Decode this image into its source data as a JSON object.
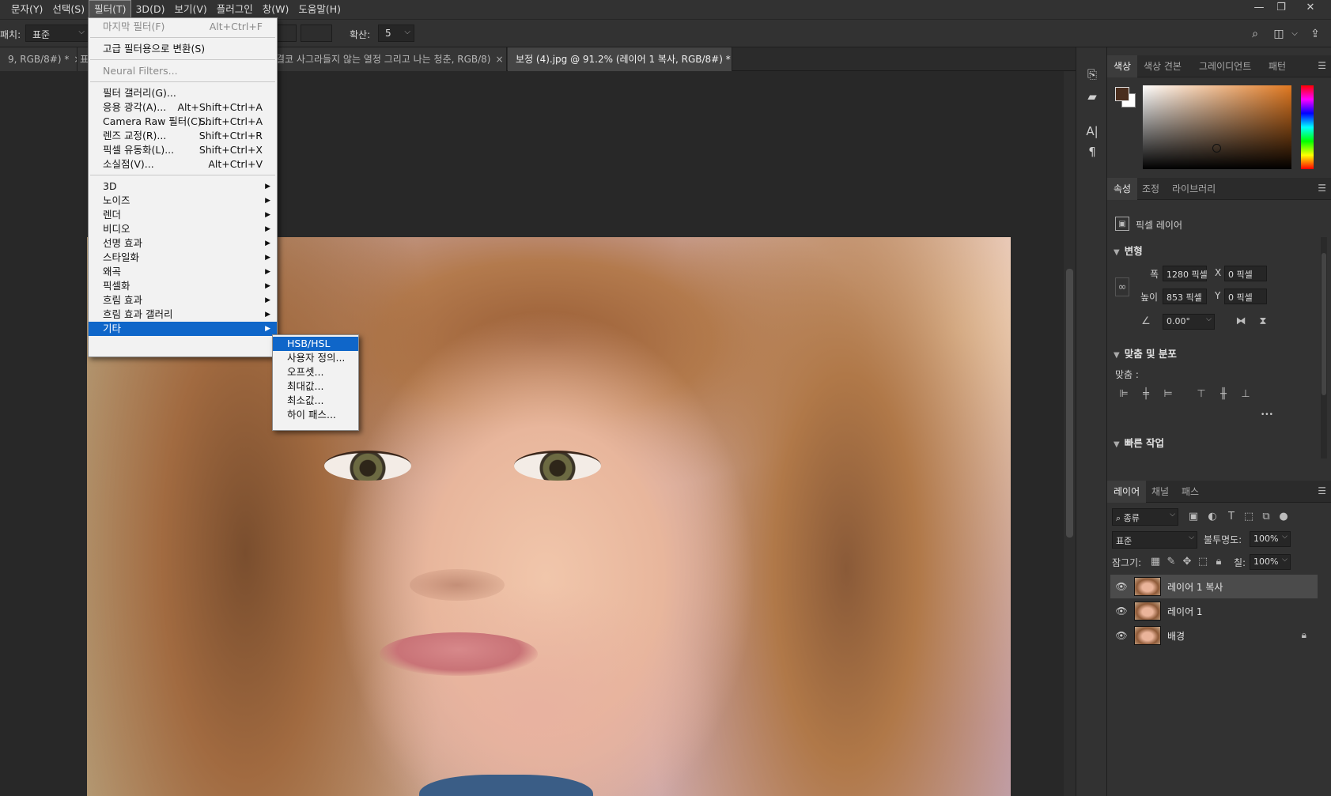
{
  "menubar": {
    "items": [
      "문자(Y)",
      "선택(S)",
      "필터(T)",
      "3D(D)",
      "보기(V)",
      "플러그인",
      "창(W)",
      "도움말(H)"
    ],
    "active_index": 2,
    "window_controls": [
      "—",
      "❐",
      "✕"
    ]
  },
  "options": {
    "patch_label": "패치:",
    "patch_value": "표준",
    "spread_label": "확산:",
    "spread_value": "5"
  },
  "tabs": [
    {
      "label": "9, RGB/8#) *",
      "active": false
    },
    {
      "label": "표",
      "active": false
    },
    {
      "label": "결코 사그라들지 않는 열정 그리고 나는 청춘, RGB/8)",
      "active": false
    },
    {
      "label": "보정 (4).jpg @ 91.2% (레이어 1 복사, RGB/8#) *",
      "active": true
    }
  ],
  "filter_menu": {
    "items": [
      {
        "label": "마지막 필터(F)",
        "shortcut": "Alt+Ctrl+F",
        "disabled": true
      },
      {
        "label": "고급 필터용으로 변환(S)"
      },
      {
        "label": "Neural Filters...",
        "disabled": true
      },
      {
        "label": "필터 갤러리(G)..."
      },
      {
        "label": "응용 광각(A)...",
        "shortcut": "Alt+Shift+Ctrl+A"
      },
      {
        "label": "Camera Raw 필터(C)...",
        "shortcut": "Shift+Ctrl+A"
      },
      {
        "label": "렌즈 교정(R)...",
        "shortcut": "Shift+Ctrl+R"
      },
      {
        "label": "픽셀 유동화(L)...",
        "shortcut": "Shift+Ctrl+X"
      },
      {
        "label": "소실점(V)...",
        "shortcut": "Alt+Ctrl+V"
      },
      {
        "label": "3D",
        "submenu": true
      },
      {
        "label": "노이즈",
        "submenu": true
      },
      {
        "label": "렌더",
        "submenu": true
      },
      {
        "label": "비디오",
        "submenu": true
      },
      {
        "label": "선명 효과",
        "submenu": true
      },
      {
        "label": "스타일화",
        "submenu": true
      },
      {
        "label": "왜곡",
        "submenu": true
      },
      {
        "label": "픽셀화",
        "submenu": true
      },
      {
        "label": "흐림 효과",
        "submenu": true
      },
      {
        "label": "흐림 효과 갤러리",
        "submenu": true
      },
      {
        "label": "기타",
        "submenu": true,
        "highlight": true
      }
    ]
  },
  "submenu": {
    "items": [
      {
        "label": "HSB/HSL",
        "highlight": true
      },
      {
        "label": "사용자 정의..."
      },
      {
        "label": "오프셋..."
      },
      {
        "label": "최대값..."
      },
      {
        "label": "최소값..."
      },
      {
        "label": "하이 패스..."
      }
    ]
  },
  "color_panel": {
    "tabs": [
      "색상",
      "색상 견본",
      "그레이디언트",
      "패턴"
    ],
    "foreground": "#4a2e1e",
    "background": "#ffffff",
    "hue": "#e07820"
  },
  "properties_panel": {
    "tabs": [
      "속성",
      "조정",
      "라이브러리"
    ],
    "layer_type": "픽셀 레이어",
    "transform_title": "변형",
    "width_label": "폭",
    "width_value": "1280 픽셀",
    "height_label": "높이",
    "height_value": "853 픽셀",
    "x_label": "X",
    "x_value": "0 픽셀",
    "y_label": "Y",
    "y_value": "0 픽셀",
    "angle_value": "0.00°",
    "align_title": "맞춤 및 분포",
    "align_label": "맞춤 :",
    "more": "•••",
    "quick_title": "빠른 작업"
  },
  "layers_panel": {
    "tabs": [
      "레이어",
      "채널",
      "패스"
    ],
    "filter_kind": "종류",
    "blend_mode": "표준",
    "opacity_label": "불투명도:",
    "opacity_value": "100%",
    "lock_label": "잠그기:",
    "fill_label": "칠:",
    "fill_value": "100%",
    "layers": [
      {
        "name": "레이어 1 복사",
        "selected": true
      },
      {
        "name": "레이어 1"
      },
      {
        "name": "배경",
        "locked": true
      }
    ]
  }
}
